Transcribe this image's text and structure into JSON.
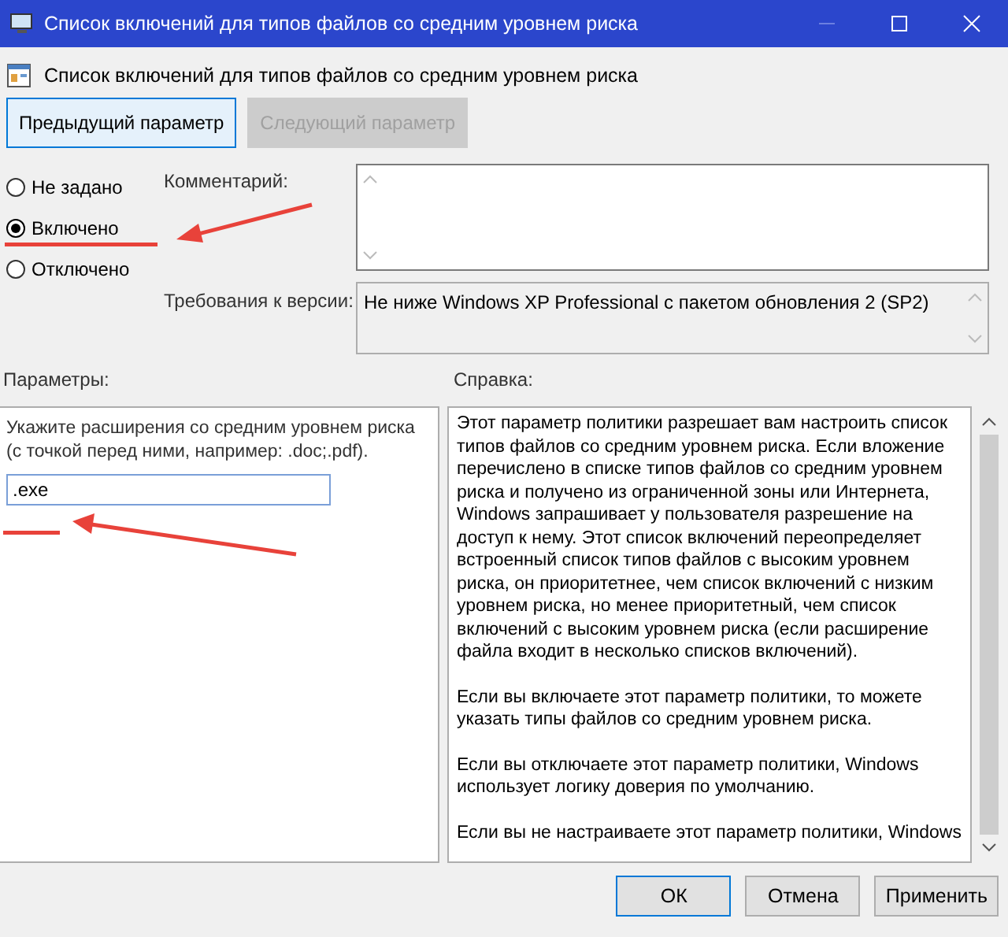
{
  "window": {
    "title": "Список включений для типов файлов со средним уровнем риска"
  },
  "header": {
    "title": "Список включений для типов файлов со средним уровнем риска"
  },
  "nav_buttons": [
    {
      "label": "Предыдущий параметр",
      "disabled": false,
      "focused": true
    },
    {
      "label": "Следующий параметр",
      "disabled": true,
      "focused": false
    }
  ],
  "state_options": [
    {
      "label": "Не задано",
      "selected": false
    },
    {
      "label": "Включено",
      "selected": true
    },
    {
      "label": "Отключено",
      "selected": false
    }
  ],
  "comment": {
    "label": "Комментарий:"
  },
  "version": {
    "label": "Требования к версии:",
    "value": "Не ниже Windows XP Professional с пакетом обновления 2 (SP2)"
  },
  "options": {
    "label": "Параметры:",
    "description": "Укажите расширения со средним уровнем риска (с точкой перед ними, например: .doc;.pdf).",
    "value": ".exe"
  },
  "help": {
    "label": "Справка:",
    "paragraphs": [
      "Этот параметр политики разрешает вам настроить список типов файлов со средним уровнем риска. Если вложение перечислено в списке типов файлов со средним уровнем риска и получено из ограниченной зоны или Интернета, Windows запрашивает у пользователя разрешение на доступ к нему. Этот список включений переопределяет встроенный список типов файлов с высоким уровнем риска, он приоритетнее, чем список включений с низким уровнем риска, но менее приоритетный, чем список включений с высоким уровнем риска (если расширение файла входит в несколько списков включений).",
      "Если вы включаете этот параметр политики, то можете указать типы файлов со средним уровнем риска.",
      "Если вы отключаете этот параметр политики, Windows использует логику доверия по умолчанию.",
      "Если вы не настраиваете этот параметр политики, Windows"
    ]
  },
  "buttons": [
    {
      "label": "ОК",
      "focused": true
    },
    {
      "label": "Отмена",
      "focused": false
    },
    {
      "label": "Применить",
      "focused": false
    }
  ]
}
